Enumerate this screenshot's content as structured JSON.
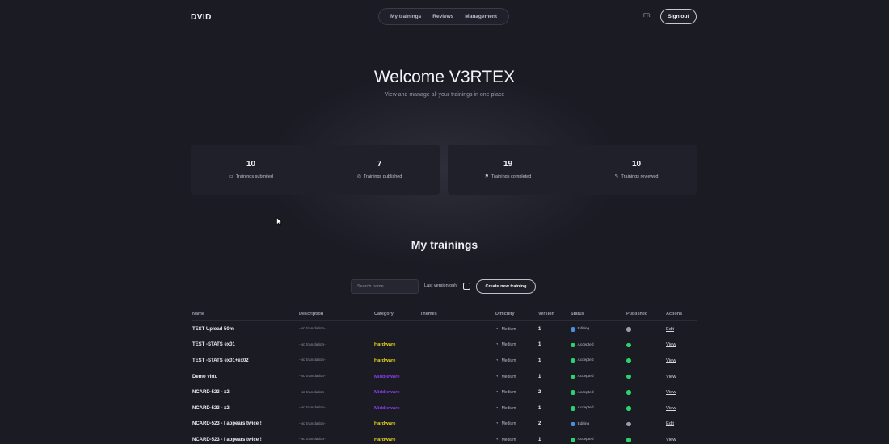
{
  "header": {
    "logo_text": "DVID",
    "nav": [
      "My trainings",
      "Reviews",
      "Management"
    ],
    "lang": "FR",
    "signout_label": "Sign out"
  },
  "hero": {
    "title": "Welcome V3RTEX",
    "subtitle": "View and manage all your trainings in one place"
  },
  "stats": [
    {
      "value": "10",
      "label": "Trainings submited",
      "icon": "screen-icon"
    },
    {
      "value": "7",
      "label": "Trainings published",
      "icon": "broadcast-icon"
    },
    {
      "value": "19",
      "label": "Trainings completed",
      "icon": "flag-icon"
    },
    {
      "value": "10",
      "label": "Trainings reviewed",
      "icon": "pen-icon"
    }
  ],
  "section_title": "My trainings",
  "controls": {
    "search_placeholder": "Search name",
    "last_version_label": "Last version only",
    "create_label": "Create new training"
  },
  "table": {
    "columns": [
      "Name",
      "Description",
      "Category",
      "Themes",
      "Difficulty",
      "Version",
      "Status",
      "Published",
      "Actions"
    ],
    "rows": [
      {
        "name": "TEST Upload 50m",
        "description": "-No translation-",
        "category": "",
        "themes": "",
        "difficulty": "Medium",
        "version": "1",
        "status": "Editing",
        "published": false,
        "action": "Edit"
      },
      {
        "name": "TEST -STATS ex01",
        "description": "-No translation-",
        "category": "Hardware",
        "themes": "",
        "difficulty": "Medium",
        "version": "1",
        "status": "Accepted",
        "published": true,
        "action": "View"
      },
      {
        "name": "TEST -STATS ex01+ex02",
        "description": "-No translation-",
        "category": "Hardware",
        "themes": "",
        "difficulty": "Medium",
        "version": "1",
        "status": "Accepted",
        "published": true,
        "action": "View"
      },
      {
        "name": "Demo virtu",
        "description": "-No translation-",
        "category": "Middleware",
        "themes": "",
        "difficulty": "Medium",
        "version": "1",
        "status": "Accepted",
        "published": true,
        "action": "View"
      },
      {
        "name": "NCARD-523 - x2",
        "description": "-No translation-",
        "category": "Middleware",
        "themes": "",
        "difficulty": "Medium",
        "version": "2",
        "status": "Accepted",
        "published": true,
        "action": "View"
      },
      {
        "name": "NCARD-523 - x2",
        "description": "-No translation-",
        "category": "Middleware",
        "themes": "",
        "difficulty": "Medium",
        "version": "1",
        "status": "Accepted",
        "published": true,
        "action": "View"
      },
      {
        "name": "NCARD-523 - I appears twice !",
        "description": "-No translation-",
        "category": "Hardware",
        "themes": "",
        "difficulty": "Medium",
        "version": "2",
        "status": "Editing",
        "published": false,
        "action": "Edit"
      },
      {
        "name": "NCARD-523 - I appears twice !",
        "description": "-No translation-",
        "category": "Hardware",
        "themes": "",
        "difficulty": "Medium",
        "version": "1",
        "status": "Accepted",
        "published": true,
        "action": "View"
      }
    ]
  },
  "colors": {
    "background": "#1b1b24",
    "hardware": "#e8d21a",
    "middleware": "#8b3ff0",
    "accepted": "#2bd46a",
    "editing": "#4a8fe0",
    "unpublished": "#9a9aa8"
  }
}
